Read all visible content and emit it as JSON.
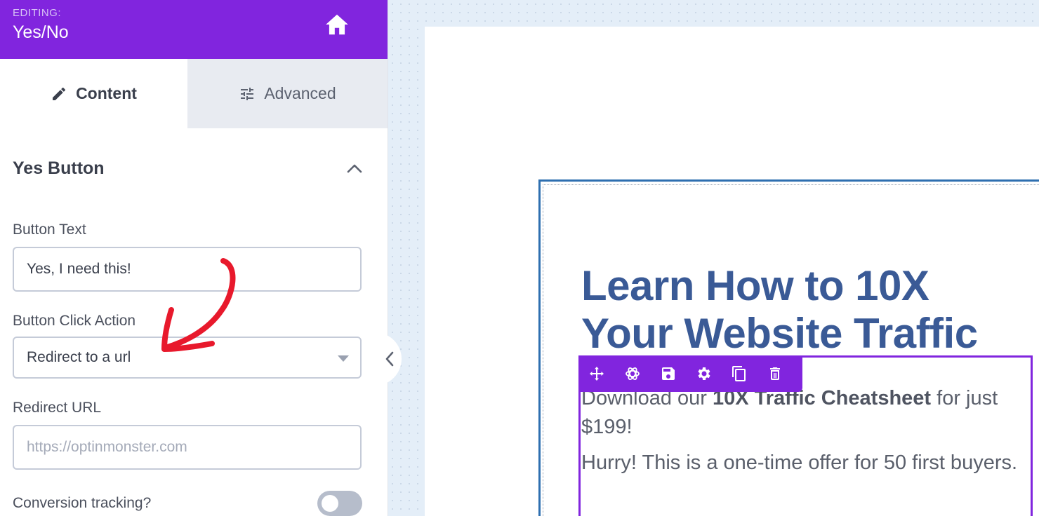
{
  "header": {
    "editing_label": "EDITING:",
    "title": "Yes/No"
  },
  "tabs": [
    {
      "label": "Content",
      "icon": "pencil-icon"
    },
    {
      "label": "Advanced",
      "icon": "sliders-icon"
    }
  ],
  "section": {
    "title": "Yes Button"
  },
  "fields": {
    "button_text": {
      "label": "Button Text",
      "value": "Yes, I need this!"
    },
    "click_action": {
      "label": "Button Click Action",
      "value": "Redirect to a url"
    },
    "redirect_url": {
      "label": "Redirect URL",
      "placeholder": "https://optinmonster.com"
    },
    "conversion_tracking": {
      "label": "Conversion tracking?",
      "enabled": false
    }
  },
  "canvas": {
    "headline": "Learn How to 10X Your Website Traffic",
    "paragraph1_prefix": "Download our ",
    "paragraph1_bold": "10X Traffic Cheatsheet",
    "paragraph1_suffix": " for just $199!",
    "paragraph2": "Hurry! This is a one-time offer for 50 first buyers."
  },
  "toolbar": {
    "icons": [
      "move-icon",
      "ai-icon",
      "save-icon",
      "settings-icon",
      "duplicate-icon",
      "delete-icon"
    ]
  },
  "colors": {
    "brand": "#8125de",
    "headline": "#3a5a96",
    "annotation": "#e8192c"
  }
}
